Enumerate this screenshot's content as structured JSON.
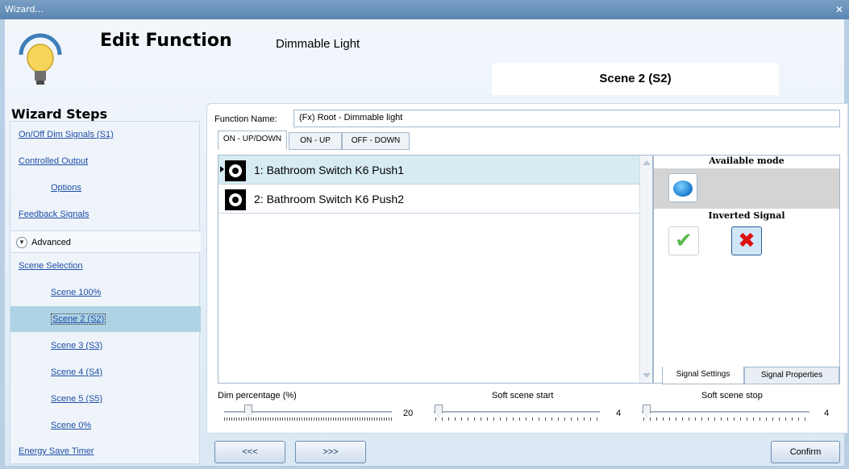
{
  "window": {
    "title": "Wizard...",
    "close_glyph": "✕"
  },
  "header": {
    "title": "Edit Function",
    "subtitle": "Dimmable Light",
    "scene_tab": "Scene 2 (S2)",
    "icon": "light-bulb-icon"
  },
  "steps": {
    "title": "Wizard Steps",
    "items": [
      {
        "label": "On/Off Dim Signals (S1)"
      },
      {
        "label": "Controlled Output"
      },
      {
        "label": "Options"
      },
      {
        "label": "Feedback Signals"
      },
      {
        "label": "Advanced"
      },
      {
        "label": "Scene Selection"
      },
      {
        "label": "Scene 100%"
      },
      {
        "label": "Scene 2 (S2)"
      },
      {
        "label": "Scene 3 (S3)"
      },
      {
        "label": "Scene 4 (S4)"
      },
      {
        "label": "Scene 5 (S5)"
      },
      {
        "label": "Scene 0%"
      },
      {
        "label": "Energy Save Timer"
      }
    ],
    "selected": "Scene 2 (S2)"
  },
  "function": {
    "label": "Function Name:",
    "value": "(Fx) Root - Dimmable light"
  },
  "tabs": [
    "ON - UP/DOWN",
    "ON - UP",
    "OFF - DOWN"
  ],
  "active_tab": "ON - UP/DOWN",
  "signals": [
    {
      "label": "1: Bathroom Switch K6 Push1",
      "icon": "push-button-icon"
    },
    {
      "label": "2: Bathroom Switch K6 Push2",
      "icon": "push-button-icon"
    }
  ],
  "side": {
    "available_mode": "Available mode",
    "inverted_signal": "Inverted Signal",
    "tab_settings": "Signal Settings",
    "tab_properties": "Signal Properties",
    "check_glyph": "✔",
    "x_glyph": "✖"
  },
  "sliders": {
    "dim": {
      "label": "Dim percentage (%)",
      "value": "20"
    },
    "start": {
      "label": "Soft scene start",
      "value": "4"
    },
    "stop": {
      "label": "Soft scene stop",
      "value": "4"
    }
  },
  "buttons": {
    "prev": "<<<",
    "next": ">>>",
    "confirm": "Confirm"
  },
  "colors": {
    "selected_row": "#d7ebf3",
    "selected_step": "#aed3e4",
    "link": "#1f4ea6"
  }
}
